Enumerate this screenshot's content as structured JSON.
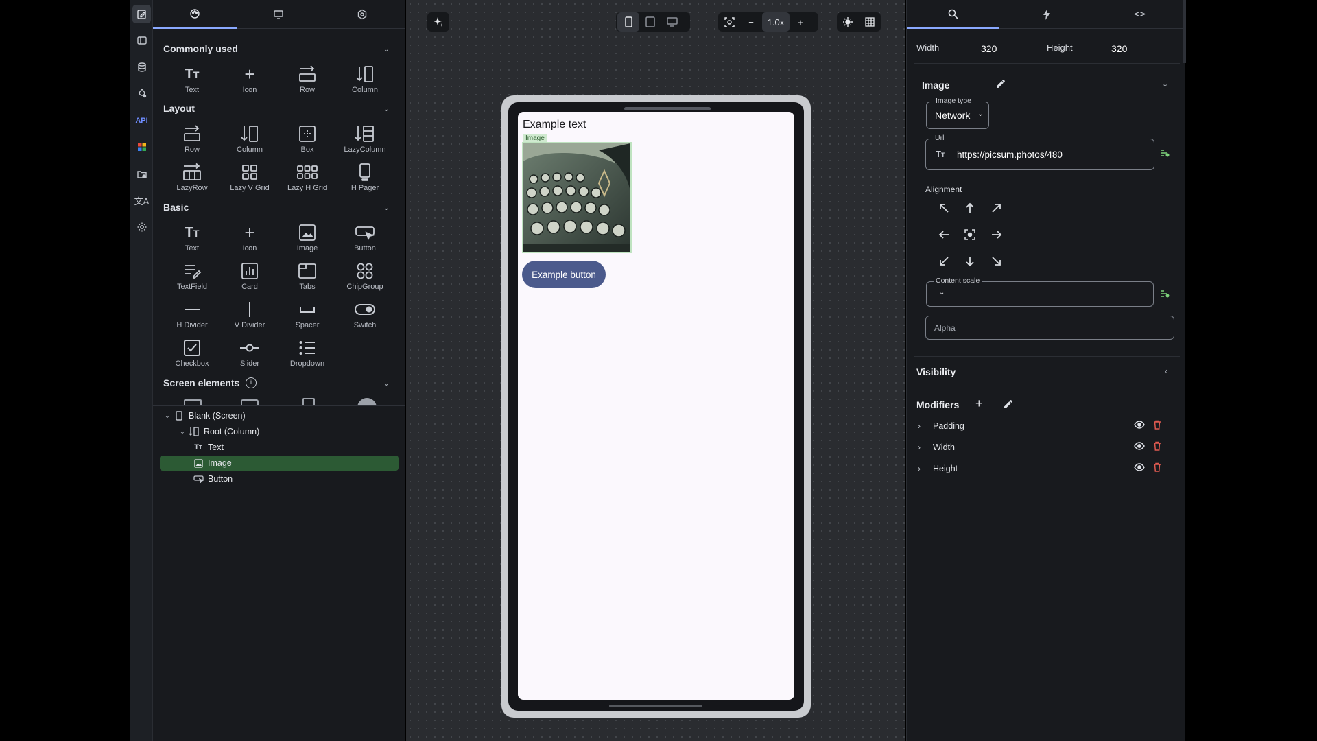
{
  "palette": {
    "sections": {
      "commonly_used": "Commonly used",
      "layout": "Layout",
      "basic": "Basic",
      "screen_elements": "Screen elements"
    },
    "commonly_used": [
      "Text",
      "Icon",
      "Row",
      "Column"
    ],
    "layout": [
      "Row",
      "Column",
      "Box",
      "LazyColumn",
      "LazyRow",
      "Lazy V Grid",
      "Lazy H Grid",
      "H Pager"
    ],
    "basic": [
      "Text",
      "Icon",
      "Image",
      "Button",
      "TextField",
      "Card",
      "Tabs",
      "ChipGroup",
      "H Divider",
      "V Divider",
      "Spacer",
      "Switch",
      "Checkbox",
      "Slider",
      "Dropdown"
    ]
  },
  "tree": {
    "screen": "Blank (Screen)",
    "root": "Root (Column)",
    "items": [
      "Text",
      "Image",
      "Button"
    ]
  },
  "toolbar": {
    "zoom": "1.0x",
    "zoom_out": "−",
    "zoom_in": "+"
  },
  "preview": {
    "text": "Example text",
    "image_tag": "Image",
    "button": "Example button"
  },
  "inspector": {
    "width_label": "Width",
    "width_value": "320",
    "height_label": "Height",
    "height_value": "320",
    "section_title": "Image",
    "image_type_label": "Image type",
    "image_type_value": "Network",
    "url_label": "Url",
    "url_value": "https://picsum.photos/480",
    "alignment_label": "Alignment",
    "content_scale_label": "Content scale",
    "alpha_placeholder": "Alpha",
    "visibility_label": "Visibility",
    "modifiers_label": "Modifiers",
    "modifiers": [
      "Padding",
      "Width",
      "Height"
    ]
  },
  "colors": {
    "accent": "#8aa9ff",
    "selected_row": "#2c5a34",
    "button_bg": "#4b5a8c",
    "delete": "#e05a50",
    "preview_bg": "#fbf8fd"
  }
}
